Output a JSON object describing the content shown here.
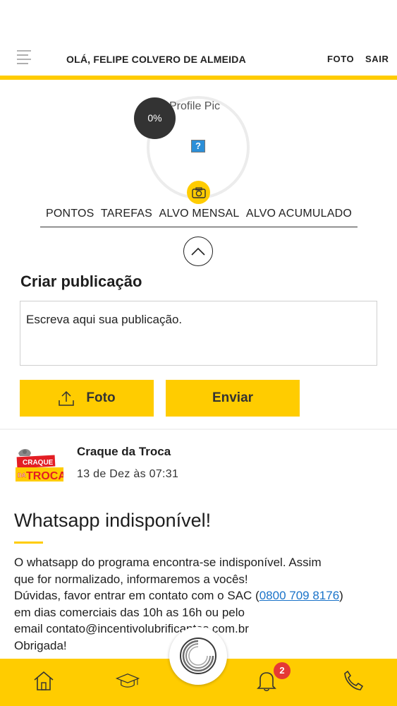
{
  "header": {
    "greeting": "OLÁ, FELIPE COLVERO DE ALMEIDA",
    "foto_link": "FOTO",
    "sair_link": "SAIR",
    "menu_icon": "hamburger-menu-icon"
  },
  "profile": {
    "image_alt_text": "Profile Pic",
    "broken_image_glyph": "?",
    "completion": "0%",
    "camera_icon": "camera-icon"
  },
  "tabs": [
    {
      "label": "PONTOS"
    },
    {
      "label": "TAREFAS"
    },
    {
      "label": "ALVO MENSAL"
    },
    {
      "label": "ALVO ACUMULADO"
    }
  ],
  "composer": {
    "title": "Criar publicação",
    "placeholder": "Escreva aqui sua publicação.",
    "photo_button": "Foto",
    "send_button": "Enviar"
  },
  "post": {
    "author": "Craque da Troca",
    "logo_text_top": "CRAQUE",
    "logo_text_da": "DA",
    "logo_text_bottom": "TROCA",
    "date": "13 de Dez às 07:31",
    "title": "Whatsapp indisponível!",
    "body_line1": "O whatsapp do programa encontra-se indisponível. Assim",
    "body_line2": "que for normalizado, informaremos a vocês!",
    "body_line3_pre": "Dúvidas, favor entrar em contato com o SAC (",
    "phone": "0800 709 8176",
    "body_line3_post": ")",
    "body_line4": "em dias comerciais das 10h as 16h ou pelo",
    "body_line5": "email contato@incentivolubrificantes.com.br",
    "body_line6": "Obrigada!"
  },
  "bottom_nav": {
    "items": [
      "home-icon",
      "graduation-cap-icon",
      "app-logo-icon",
      "bell-icon",
      "phone-icon"
    ],
    "notification_count": "2"
  },
  "colors": {
    "accent_yellow": "#ffcc00",
    "badge_red": "#e53935",
    "link_blue": "#1a73c9",
    "dark_badge": "#333333"
  }
}
